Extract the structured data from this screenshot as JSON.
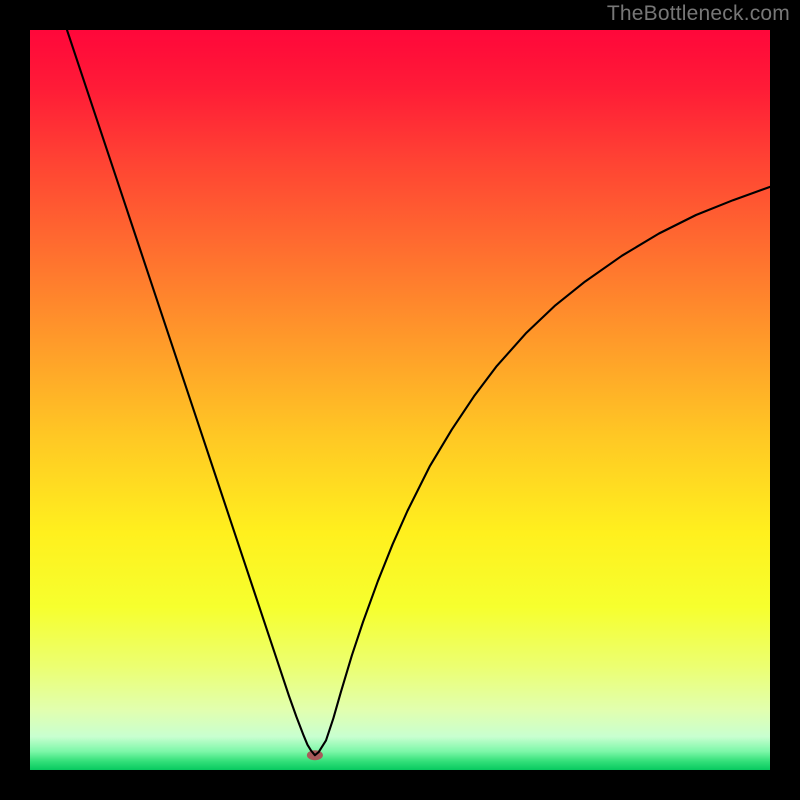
{
  "watermark": "TheBottleneck.com",
  "chart_data": {
    "type": "line",
    "title": "",
    "xlabel": "",
    "ylabel": "",
    "xlim": [
      0,
      100
    ],
    "ylim": [
      0,
      100
    ],
    "show_axes": false,
    "background_gradient": {
      "stops": [
        {
          "offset": 0.0,
          "color": "#ff073a"
        },
        {
          "offset": 0.08,
          "color": "#ff1c37"
        },
        {
          "offset": 0.18,
          "color": "#ff4433"
        },
        {
          "offset": 0.3,
          "color": "#ff6f2f"
        },
        {
          "offset": 0.42,
          "color": "#ff9a2a"
        },
        {
          "offset": 0.55,
          "color": "#ffc824"
        },
        {
          "offset": 0.68,
          "color": "#fff01e"
        },
        {
          "offset": 0.78,
          "color": "#f6ff2e"
        },
        {
          "offset": 0.86,
          "color": "#ecff71"
        },
        {
          "offset": 0.92,
          "color": "#e1ffb0"
        },
        {
          "offset": 0.955,
          "color": "#c8ffd0"
        },
        {
          "offset": 0.975,
          "color": "#7cf7a8"
        },
        {
          "offset": 0.988,
          "color": "#34e07a"
        },
        {
          "offset": 1.0,
          "color": "#08c95f"
        }
      ]
    },
    "marker": {
      "x": 38.5,
      "y": 2.0,
      "color": "#a85a5a",
      "rx": 8,
      "ry": 5
    },
    "series": [
      {
        "name": "bottleneck-curve",
        "stroke": "#000000",
        "stroke_width": 2.1,
        "x": [
          5.0,
          7.0,
          9.0,
          11.0,
          13.0,
          15.0,
          17.0,
          19.0,
          21.0,
          23.0,
          25.0,
          27.0,
          29.0,
          31.0,
          33.0,
          35.0,
          36.0,
          37.0,
          37.5,
          38.0,
          38.5,
          39.0,
          40.0,
          41.0,
          42.0,
          43.5,
          45.0,
          47.0,
          49.0,
          51.0,
          54.0,
          57.0,
          60.0,
          63.0,
          67.0,
          71.0,
          75.0,
          80.0,
          85.0,
          90.0,
          95.0,
          100.0
        ],
        "y": [
          100.0,
          94.0,
          88.0,
          82.0,
          76.0,
          70.0,
          64.0,
          58.0,
          52.0,
          46.0,
          40.0,
          34.0,
          28.0,
          22.0,
          16.0,
          10.0,
          7.2,
          4.6,
          3.4,
          2.6,
          2.0,
          2.4,
          4.0,
          7.0,
          10.5,
          15.5,
          20.0,
          25.5,
          30.5,
          35.0,
          41.0,
          46.0,
          50.5,
          54.5,
          59.0,
          62.8,
          66.0,
          69.5,
          72.5,
          75.0,
          77.0,
          78.8
        ]
      }
    ]
  }
}
